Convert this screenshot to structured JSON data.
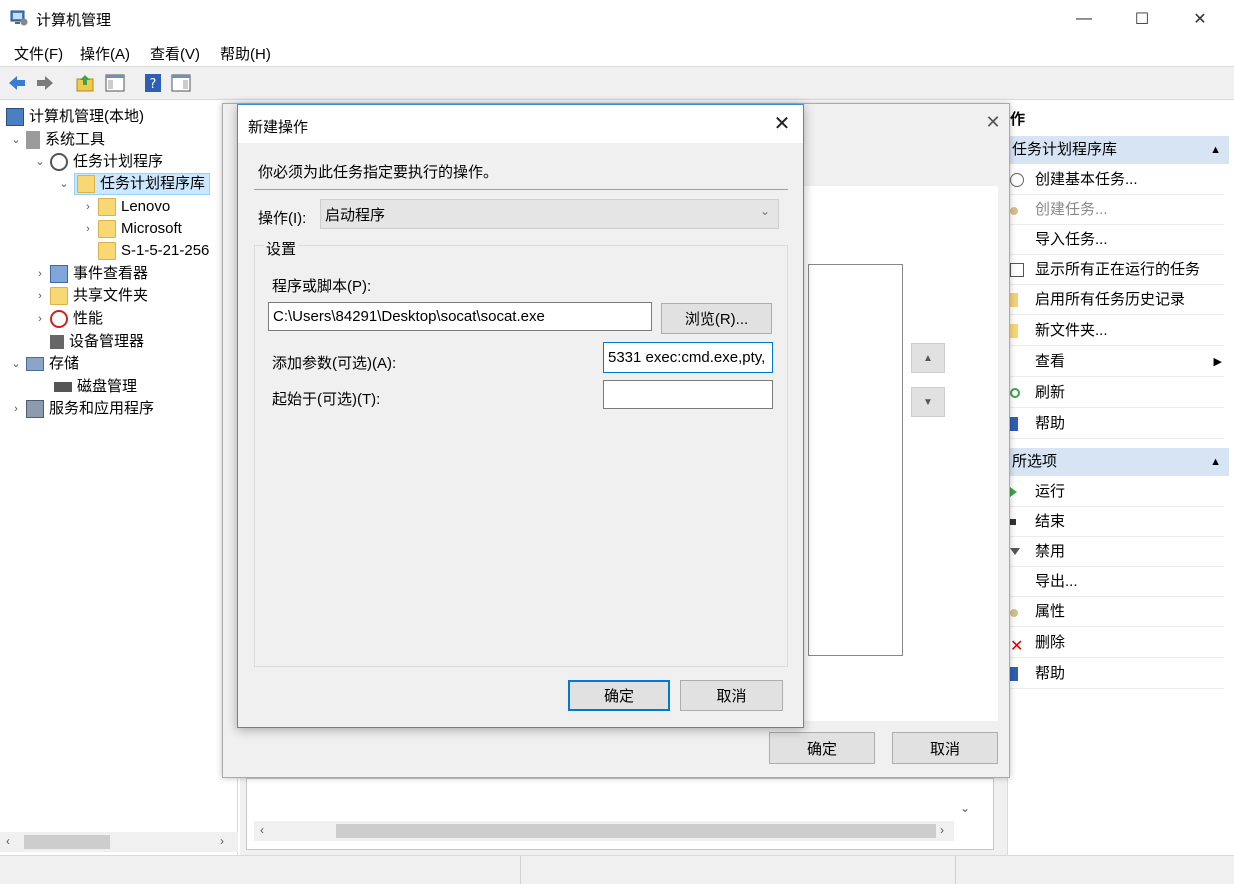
{
  "window": {
    "title": "计算机管理",
    "minimize_icon": "—",
    "maximize_icon": "☐",
    "close_icon": "✕"
  },
  "menu": {
    "file": "文件(F)",
    "action": "操作(A)",
    "view": "查看(V)",
    "help": "帮助(H)"
  },
  "tree": {
    "items": [
      {
        "label": "计算机管理(本地)"
      },
      {
        "label": "系统工具"
      },
      {
        "label": "任务计划程序"
      },
      {
        "label": "任务计划程序库"
      },
      {
        "label": "Lenovo"
      },
      {
        "label": "Microsoft"
      },
      {
        "label": "S-1-5-21-256"
      },
      {
        "label": "事件查看器"
      },
      {
        "label": "共享文件夹"
      },
      {
        "label": "性能"
      },
      {
        "label": "设备管理器"
      },
      {
        "label": "存储"
      },
      {
        "label": "磁盘管理"
      },
      {
        "label": "服务和应用程序"
      }
    ]
  },
  "actions": {
    "header": "作",
    "section1": {
      "title": "任务计划程序库",
      "items": [
        {
          "label": "创建基本任务..."
        },
        {
          "label": "创建任务..."
        },
        {
          "label": "导入任务..."
        },
        {
          "label": "显示所有正在运行的任务"
        },
        {
          "label": "启用所有任务历史记录"
        },
        {
          "label": "新文件夹..."
        },
        {
          "label": "查看"
        },
        {
          "label": "刷新"
        },
        {
          "label": "帮助"
        }
      ]
    },
    "section2": {
      "title": "所选项",
      "items": [
        {
          "label": "运行"
        },
        {
          "label": "结束"
        },
        {
          "label": "禁用"
        },
        {
          "label": "导出..."
        },
        {
          "label": "属性"
        },
        {
          "label": "删除"
        },
        {
          "label": "帮助"
        }
      ]
    }
  },
  "outer_dialog": {
    "ok": "确定",
    "cancel": "取消"
  },
  "dialog": {
    "title": "新建操作",
    "instruction": "你必须为此任务指定要执行的操作。",
    "action_label": "操作(I):",
    "action_value": "启动程序",
    "settings_label": "设置",
    "program_label": "程序或脚本(P):",
    "program_value": "C:\\Users\\84291\\Desktop\\socat\\socat.exe",
    "browse": "浏览(R)...",
    "args_label": "添加参数(可选)(A):",
    "args_value": "5331 exec:cmd.exe,pty,",
    "start_label": "起始于(可选)(T):",
    "start_value": "",
    "ok": "确定",
    "cancel": "取消"
  }
}
